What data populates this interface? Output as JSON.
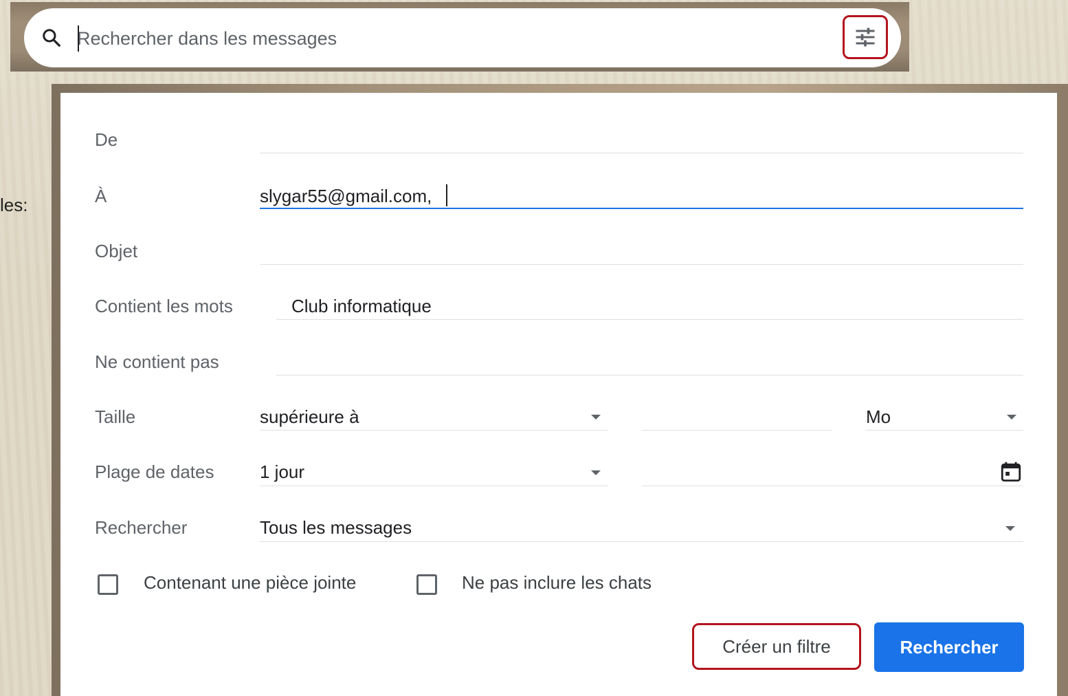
{
  "search": {
    "placeholder": "Rechercher dans les messages"
  },
  "left_clip_text": "les:",
  "panel": {
    "fields": {
      "from": {
        "label": "De",
        "value": ""
      },
      "to": {
        "label": "À",
        "value": "slygar55@gmail.com,"
      },
      "subject": {
        "label": "Objet",
        "value": ""
      },
      "has_words": {
        "label": "Contient les mots",
        "value": "Club informatique"
      },
      "not_words": {
        "label": "Ne contient pas",
        "value": ""
      },
      "size": {
        "label": "Taille",
        "operator": "supérieure à",
        "value": "",
        "unit": "Mo"
      },
      "date_range": {
        "label": "Plage de dates",
        "value": "1 jour",
        "date": ""
      },
      "search_in": {
        "label": "Rechercher",
        "value": "Tous les messages"
      }
    },
    "checkboxes": {
      "has_attachment": {
        "label": "Contenant une pièce jointe",
        "checked": false
      },
      "exclude_chats": {
        "label": "Ne pas inclure les chats",
        "checked": false
      }
    },
    "buttons": {
      "create_filter": "Créer un filtre",
      "search": "Rechercher"
    }
  },
  "colors": {
    "accent": "#1a73e8",
    "highlight_border": "#b3131b"
  },
  "icons": [
    "search-icon",
    "tune-icon",
    "dropdown-arrow-icon",
    "calendar-icon"
  ]
}
